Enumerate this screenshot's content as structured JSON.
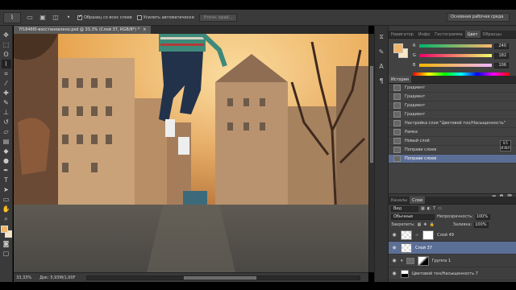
{
  "options_bar": {
    "checkboxes": [
      {
        "label": "Образец со всех слоев",
        "checked": true
      },
      {
        "label": "Усилить автоматически",
        "checked": false
      }
    ],
    "refine_button": "Уточн. край...",
    "workspace": "Основная рабочая среда"
  },
  "document": {
    "tab_title": "7f1846f0-восстановлено.psd @ 33,3% (Слой 37, RGB/8*) *",
    "tab_close": "×",
    "zoom": "33,33%",
    "doc_size": "Док: 5,93M/1,00F"
  },
  "color_panel": {
    "tabs": [
      "Навигатор",
      "Инфо",
      "Гистограмма",
      "Цвет",
      "Образцы"
    ],
    "active_tab": "Цвет",
    "foreground": "#f0b66a",
    "background": "#f7e7c6",
    "sliders": [
      {
        "label": "R",
        "value": "240"
      },
      {
        "label": "G",
        "value": "182"
      },
      {
        "label": "B",
        "value": "106"
      }
    ]
  },
  "history_panel": {
    "title": "История",
    "items": [
      "Градиент",
      "Градиент",
      "Градиент",
      "Градиент",
      "Настройка слоя \"Цветовой тон/Насыщенность\"",
      "Рамка",
      "Новый слой",
      "Поправи слоев",
      "Поправи слоев"
    ],
    "selected_index": 8,
    "tooltip": "0/1 ИЗВЛ"
  },
  "layers_panel": {
    "tabs": [
      "Каналы",
      "Слои"
    ],
    "active_tab": "Слои",
    "kind_filter": "Вид",
    "blend_mode": "Обычные",
    "opacity_label": "Непрозрачность:",
    "opacity_value": "100%",
    "lock_label": "Закрепить:",
    "fill_label": "Заливка:",
    "fill_value": "100%",
    "layers": [
      {
        "name": "Слой 49",
        "thumb": "checker",
        "mask": "white",
        "selected": false
      },
      {
        "name": "Слой 37",
        "thumb": "checker",
        "mask": "",
        "selected": true
      },
      {
        "name": "Группа 1",
        "thumb": "folder",
        "mask": "mask",
        "selected": false
      },
      {
        "name": "Цветовой тон/Насыщенность 7",
        "thumb": "adjust",
        "mask": "white",
        "selected": false
      }
    ]
  }
}
